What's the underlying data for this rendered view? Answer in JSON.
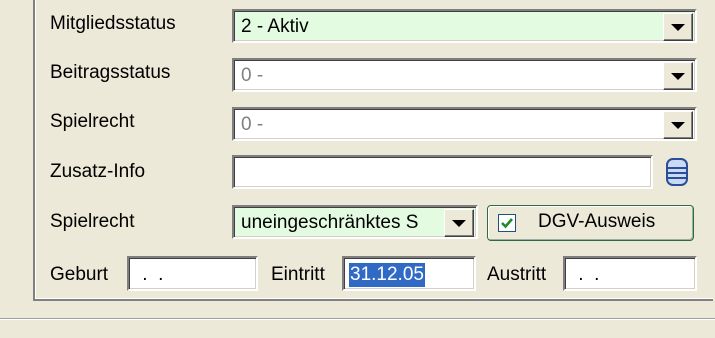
{
  "fields": {
    "mitgliedsstatus": {
      "label": "Mitgliedsstatus",
      "value": "2 - Aktiv",
      "bg": "#E3FCE1"
    },
    "beitragsstatus": {
      "label": "Beitragsstatus",
      "value": "0 -"
    },
    "spielrecht1": {
      "label": "Spielrecht",
      "value": "0 -"
    },
    "zusatzinfo": {
      "label": "Zusatz-Info",
      "value": ""
    },
    "spielrecht2": {
      "label": "Spielrecht",
      "value": "uneingeschränktes S",
      "bg": "#E3FCE1"
    },
    "dgv_button": {
      "label": "DGV-Ausweis",
      "checked": true
    },
    "geburt": {
      "label": "Geburt",
      "value": " .  ."
    },
    "eintritt": {
      "label": "Eintritt",
      "value": "31.12.05"
    },
    "austritt": {
      "label": "Austritt",
      "value": " .  ."
    }
  },
  "icons": {
    "dropdown": "triangle-down-icon",
    "info_list": "list-icon",
    "checkbox": "checkmark-icon"
  },
  "colors": {
    "window_bg": "#ECE9D8",
    "highlight": "#316AC5",
    "accent_green": "#E3FCE1"
  }
}
